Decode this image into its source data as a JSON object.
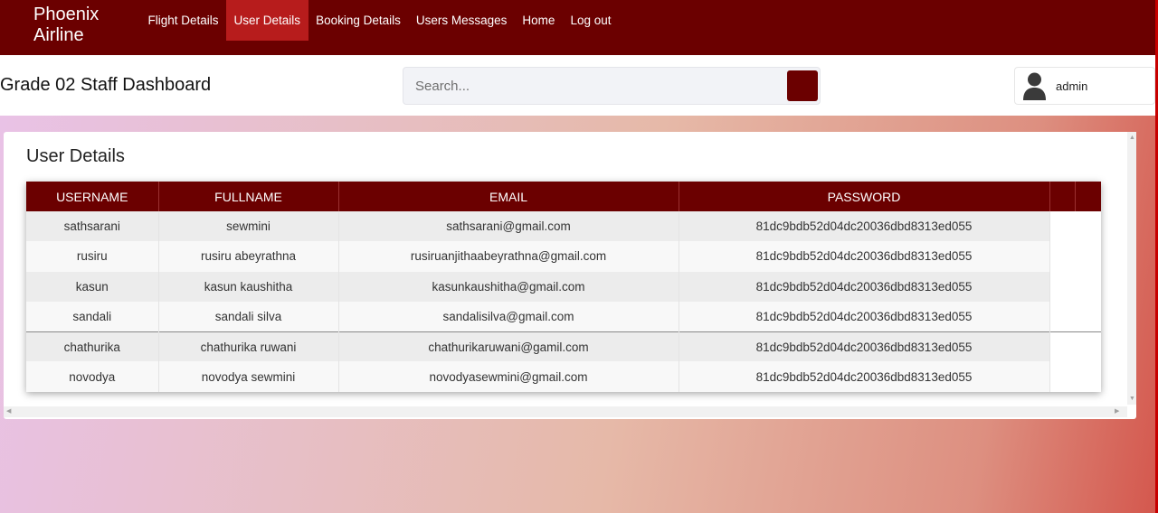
{
  "brand": {
    "line1": "Phoenix",
    "line2": "Airline"
  },
  "nav": {
    "items": [
      {
        "label": "Flight Details",
        "active": false
      },
      {
        "label": "User Details",
        "active": true
      },
      {
        "label": "Booking Details",
        "active": false
      },
      {
        "label": "Users Messages",
        "active": false
      },
      {
        "label": "Home",
        "active": false
      },
      {
        "label": "Log out",
        "active": false
      }
    ]
  },
  "header": {
    "title": "Grade 02 Staff Dashboard",
    "search_placeholder": "Search...",
    "user": "admin"
  },
  "card": {
    "title": "User Details",
    "columns": [
      "USERNAME",
      "FULLNAME",
      "EMAIL",
      "PASSWORD"
    ],
    "rows": [
      [
        "sathsarani",
        "sewmini",
        "sathsarani@gmail.com",
        "81dc9bdb52d04dc20036dbd8313ed055"
      ],
      [
        "rusiru",
        "rusiru abeyrathna",
        "rusiruanjithaabeyrathna@gmail.com",
        "81dc9bdb52d04dc20036dbd8313ed055"
      ],
      [
        "kasun",
        "kasun kaushitha",
        "kasunkaushitha@gmail.com",
        "81dc9bdb52d04dc20036dbd8313ed055"
      ],
      [
        "sandali",
        "sandali silva",
        "sandalisilva@gmail.com",
        "81dc9bdb52d04dc20036dbd8313ed055"
      ],
      [
        "chathurika",
        "chathurika ruwani",
        "chathurikaruwani@gamil.com",
        "81dc9bdb52d04dc20036dbd8313ed055"
      ],
      [
        "novodya",
        "novodya sewmini",
        "novodyasewmini@gmail.com",
        "81dc9bdb52d04dc20036dbd8313ed055"
      ]
    ]
  },
  "colors": {
    "primary": "#6b0000",
    "active_tab": "#b71c1c"
  },
  "icons": {
    "search": "search-icon",
    "avatar": "user-avatar-icon"
  }
}
